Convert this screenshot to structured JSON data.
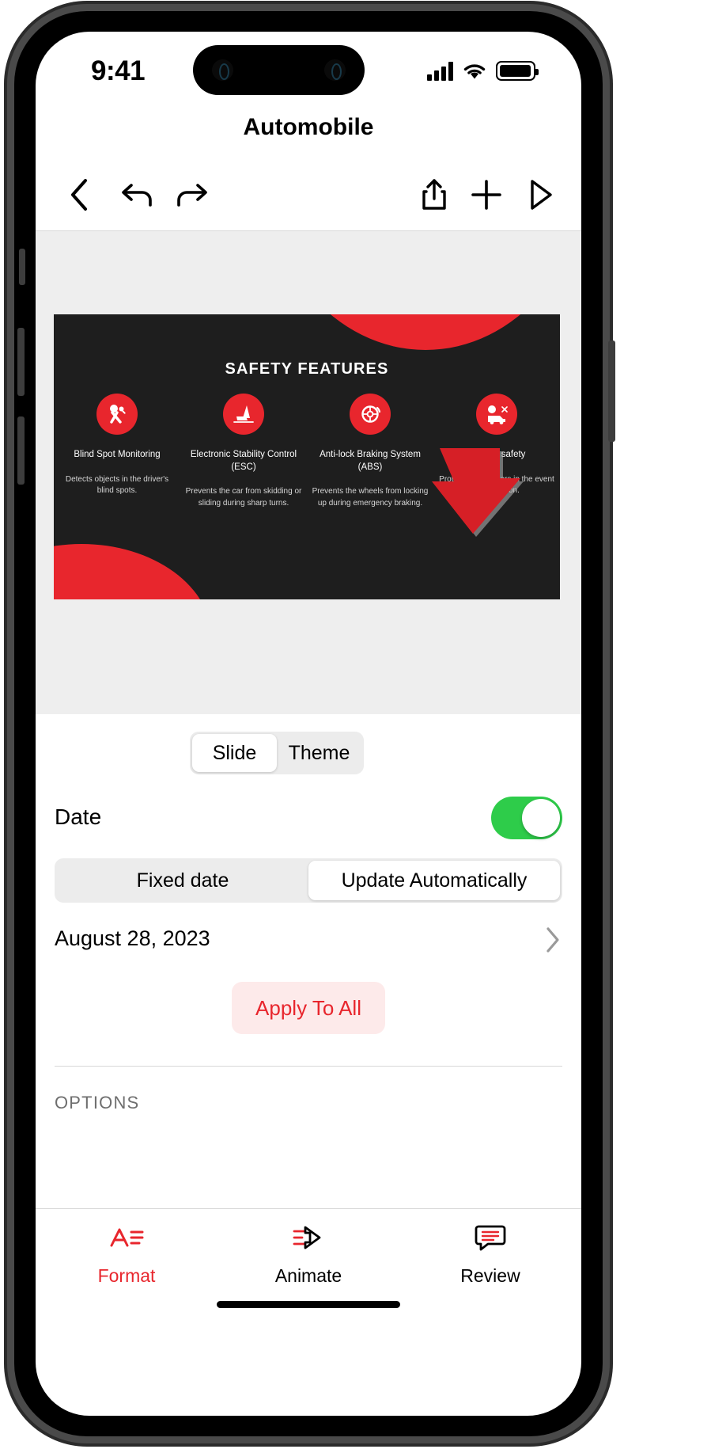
{
  "status_bar": {
    "time": "9:41",
    "icons": [
      "cellular-signal-icon",
      "wifi-icon",
      "battery-icon"
    ]
  },
  "header": {
    "title": "Automobile"
  },
  "toolbar": {
    "items": [
      {
        "name": "back-button",
        "icon": "chevron-left-icon"
      },
      {
        "name": "undo-button",
        "icon": "undo-arrow-icon"
      },
      {
        "name": "redo-button",
        "icon": "redo-arrow-icon"
      },
      {
        "name": "share-button",
        "icon": "share-icon"
      },
      {
        "name": "add-button",
        "icon": "plus-icon"
      },
      {
        "name": "play-button",
        "icon": "play-triangle-icon"
      }
    ]
  },
  "slide": {
    "title": "SAFETY FEATURES",
    "background_color": "#1e1e1e",
    "accent_color": "#e8262d",
    "features": [
      {
        "icon": "seatbelt-person-icon",
        "name": "Blind Spot Monitoring",
        "description": "Detects objects in the driver's blind spots."
      },
      {
        "icon": "car-seat-icon",
        "name": "Electronic Stability Control (ESC)",
        "description": "Prevents the car from skidding or sliding during sharp turns."
      },
      {
        "icon": "brake-disc-icon",
        "name": "Anti-lock Braking System (ABS)",
        "description": "Prevents the wheels from locking up during emergency braking."
      },
      {
        "icon": "airbag-car-icon",
        "name": "Airbags safety",
        "description": "Protects passengers in the event of a collision."
      }
    ],
    "footer_left": "",
    "footer_mid": "",
    "footer_right": ""
  },
  "annotation": {
    "arrow": "red-arrow-pointing-down-left",
    "arrow_color": "#d61f26"
  },
  "inspector": {
    "segmented_scope": {
      "options": [
        "Slide",
        "Theme"
      ],
      "selected": "Slide"
    },
    "date": {
      "label": "Date",
      "enabled": true,
      "toggle_color": "#2ecc4a",
      "mode_options": [
        "Fixed date",
        "Update Automatically"
      ],
      "mode_selected": "Update Automatically",
      "value": "August 28, 2023",
      "chevron": "chevron-right-icon"
    },
    "apply_to_all_label": "Apply To All",
    "apply_to_all_color": "#e8262d",
    "options_header": "OPTIONS"
  },
  "tab_bar": {
    "tabs": [
      {
        "label": "Format",
        "icon": "format-text-icon",
        "active": true
      },
      {
        "label": "Animate",
        "icon": "animate-arrow-icon",
        "active": false
      },
      {
        "label": "Review",
        "icon": "comment-bubble-icon",
        "active": false
      }
    ]
  }
}
